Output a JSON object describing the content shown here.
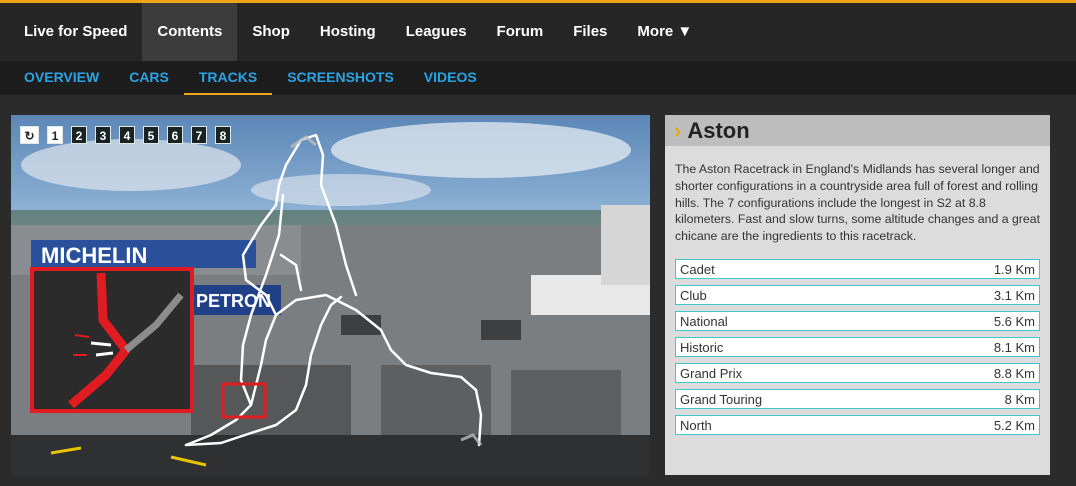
{
  "nav": {
    "items": [
      {
        "label": "Live for Speed",
        "active": false
      },
      {
        "label": "Contents",
        "active": true
      },
      {
        "label": "Shop",
        "active": false
      },
      {
        "label": "Hosting",
        "active": false
      },
      {
        "label": "Leagues",
        "active": false
      },
      {
        "label": "Forum",
        "active": false
      },
      {
        "label": "Files",
        "active": false
      },
      {
        "label": "More ▼",
        "active": false
      }
    ]
  },
  "subnav": {
    "items": [
      {
        "label": "OVERVIEW",
        "active": false
      },
      {
        "label": "CARS",
        "active": false
      },
      {
        "label": "TRACKS",
        "active": true
      },
      {
        "label": "SCREENSHOTS",
        "active": false
      },
      {
        "label": "VIDEOS",
        "active": false
      }
    ]
  },
  "viewer": {
    "reload_icon": "reload-icon",
    "reload_glyph": "↻",
    "pages": [
      "1",
      "2",
      "3",
      "4",
      "5",
      "6",
      "7",
      "8"
    ],
    "selected_page": "1",
    "banner_text": "MICHELIN",
    "sponsor_text": "PETRON",
    "colors": {
      "highlight": "#e11b22",
      "track": "#ffffff"
    }
  },
  "track": {
    "chevron": "›",
    "name": "Aston",
    "description": "The Aston Racetrack in England's Midlands has several longer and shorter configurations in a countryside area full of forest and rolling hills. The 7 configurations include the longest in S2 at 8.8 kilometers. Fast and slow turns, some altitude changes and a great chicane are the ingredients to this racetrack.",
    "configurations": [
      {
        "name": "Cadet",
        "length": "1.9 Km"
      },
      {
        "name": "Club",
        "length": "3.1 Km"
      },
      {
        "name": "National",
        "length": "5.6 Km"
      },
      {
        "name": "Historic",
        "length": "8.1 Km"
      },
      {
        "name": "Grand Prix",
        "length": "8.8 Km"
      },
      {
        "name": "Grand Touring",
        "length": "8 Km"
      },
      {
        "name": "North",
        "length": "5.2 Km"
      }
    ]
  }
}
